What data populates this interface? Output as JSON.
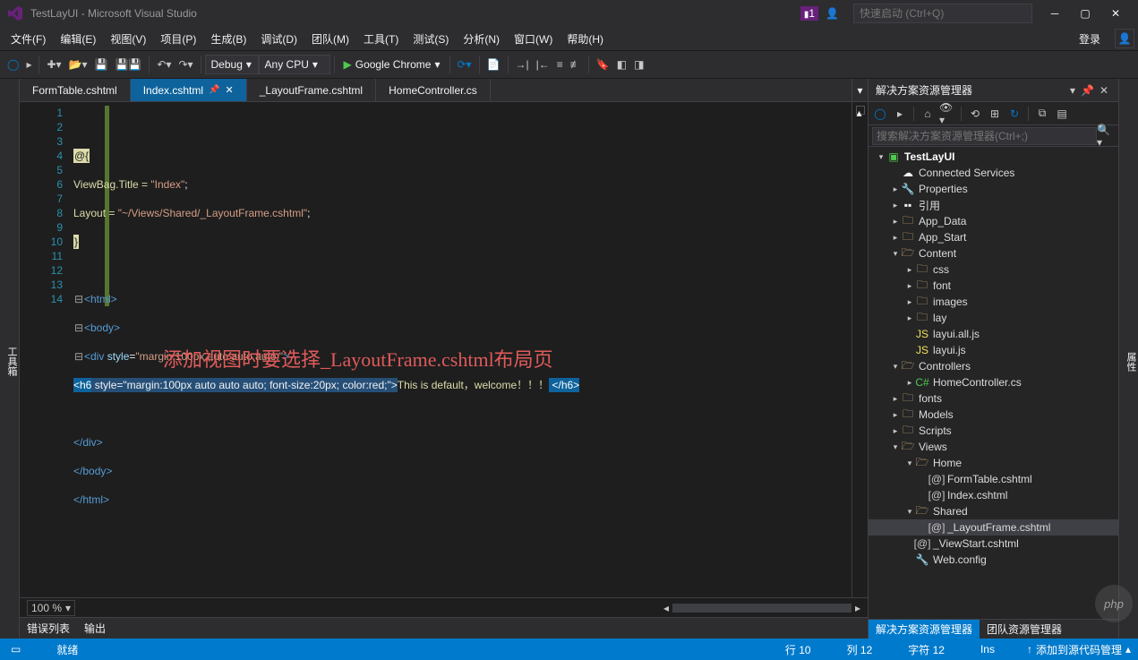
{
  "title": "TestLayUI - Microsoft Visual Studio",
  "quick_launch_placeholder": "快速启动 (Ctrl+Q)",
  "flag_count": "1",
  "login_label": "登录",
  "menu": [
    "文件(F)",
    "编辑(E)",
    "视图(V)",
    "项目(P)",
    "生成(B)",
    "调试(D)",
    "团队(M)",
    "工具(T)",
    "测试(S)",
    "分析(N)",
    "窗口(W)",
    "帮助(H)"
  ],
  "toolbar": {
    "config": "Debug",
    "platform": "Any CPU",
    "run_target": "Google Chrome"
  },
  "left_strip": "工具箱",
  "right_strip": "属性",
  "tabs": [
    {
      "label": "FormTable.cshtml",
      "active": false
    },
    {
      "label": "Index.cshtml",
      "active": true
    },
    {
      "label": "_LayoutFrame.cshtml",
      "active": false
    },
    {
      "label": "HomeController.cs",
      "active": false
    }
  ],
  "code_lines": {
    "1": "",
    "2": "@{",
    "3_a": "ViewBag.Title = ",
    "3_b": "\"Index\"",
    "3_c": ";",
    "4_a": "Layout = ",
    "4_b": "\"~/Views/Shared/_LayoutFrame.cshtml\"",
    "4_c": ";",
    "5": "}",
    "7": "<html>",
    "8": "<body>",
    "9_a": "<div ",
    "9_b": "style",
    "9_c": "=",
    "9_d": "\"margin:100px auto auto auto;\"",
    "9_e": ">",
    "10_a": "<h6",
    "10_b": " style=\"margin:100px auto auto auto; font-size:20px; color:red;\">",
    "10_c": "This is default，welcome！！！",
    "10_d": " </h6>",
    "12": "</div>",
    "13": "</body>",
    "14": "</html>"
  },
  "annotation_text": "添加视图时要选择_LayoutFrame.cshtml布局页",
  "zoom": "100 %",
  "error_tabs": [
    "错误列表",
    "输出"
  ],
  "statusbar": {
    "ready": "就绪",
    "line": "行 10",
    "col": "列 12",
    "char": "字符 12",
    "ins": "Ins",
    "source": "添加到源代码管理"
  },
  "solution": {
    "title": "解决方案资源管理器",
    "search_placeholder": "搜索解决方案资源管理器(Ctrl+;)",
    "bottom_tabs": [
      "解决方案资源管理器",
      "团队资源管理器"
    ],
    "tree": [
      {
        "d": 0,
        "ar": "▾",
        "ic": "cs",
        "lab": "TestLayUI",
        "bold": true
      },
      {
        "d": 1,
        "ar": "",
        "ic": "cloud",
        "lab": "Connected Services"
      },
      {
        "d": 1,
        "ar": "▸",
        "ic": "wrench",
        "lab": "Properties"
      },
      {
        "d": 1,
        "ar": "▸",
        "ic": "ref",
        "lab": "引用"
      },
      {
        "d": 1,
        "ar": "▸",
        "ic": "folder",
        "lab": "App_Data"
      },
      {
        "d": 1,
        "ar": "▸",
        "ic": "folder",
        "lab": "App_Start"
      },
      {
        "d": 1,
        "ar": "▾",
        "ic": "folderopen",
        "lab": "Content"
      },
      {
        "d": 2,
        "ar": "▸",
        "ic": "folder",
        "lab": "css"
      },
      {
        "d": 2,
        "ar": "▸",
        "ic": "folder",
        "lab": "font"
      },
      {
        "d": 2,
        "ar": "▸",
        "ic": "folder",
        "lab": "images"
      },
      {
        "d": 2,
        "ar": "▸",
        "ic": "folder",
        "lab": "lay"
      },
      {
        "d": 2,
        "ar": "",
        "ic": "js",
        "lab": "layui.all.js"
      },
      {
        "d": 2,
        "ar": "",
        "ic": "js",
        "lab": "layui.js"
      },
      {
        "d": 1,
        "ar": "▾",
        "ic": "folderopen",
        "lab": "Controllers"
      },
      {
        "d": 2,
        "ar": "▸",
        "ic": "csharp",
        "lab": "HomeController.cs"
      },
      {
        "d": 1,
        "ar": "▸",
        "ic": "folder",
        "lab": "fonts"
      },
      {
        "d": 1,
        "ar": "▸",
        "ic": "folder",
        "lab": "Models"
      },
      {
        "d": 1,
        "ar": "▸",
        "ic": "folder",
        "lab": "Scripts"
      },
      {
        "d": 1,
        "ar": "▾",
        "ic": "folderopen",
        "lab": "Views"
      },
      {
        "d": 2,
        "ar": "▾",
        "ic": "folderopen",
        "lab": "Home"
      },
      {
        "d": 3,
        "ar": "",
        "ic": "view",
        "lab": "FormTable.cshtml"
      },
      {
        "d": 3,
        "ar": "",
        "ic": "view",
        "lab": "Index.cshtml"
      },
      {
        "d": 2,
        "ar": "▾",
        "ic": "folderopen",
        "lab": "Shared"
      },
      {
        "d": 3,
        "ar": "",
        "ic": "view",
        "lab": "_LayoutFrame.cshtml",
        "sel": true
      },
      {
        "d": 2,
        "ar": "",
        "ic": "view",
        "lab": "_ViewStart.cshtml"
      },
      {
        "d": 2,
        "ar": "",
        "ic": "config",
        "lab": "Web.config"
      }
    ]
  },
  "watermark": "php"
}
